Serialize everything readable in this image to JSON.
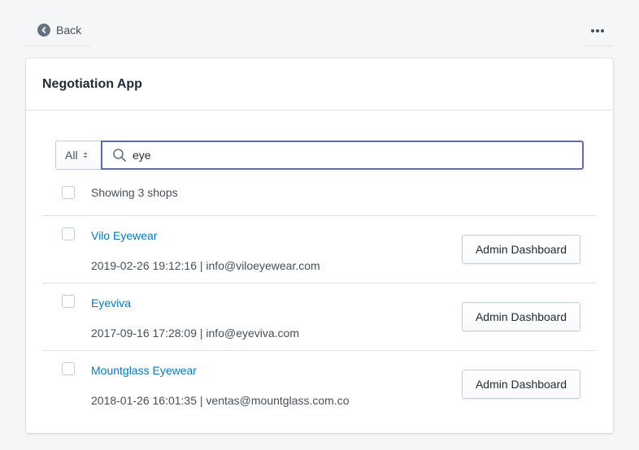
{
  "topbar": {
    "back_label": "Back",
    "back_icon": "chevron-left-circle-icon",
    "more_icon": "horizontal-dots-icon"
  },
  "card": {
    "title": "Negotiation App"
  },
  "filter": {
    "selected": "All",
    "search_value": "eye",
    "search_icon": "search-icon",
    "accent_color": "#5c6ac4"
  },
  "results": {
    "summary": "Showing 3 shops"
  },
  "shops": [
    {
      "name": "Vilo Eyewear",
      "meta": "2019-02-26 19:12:16 | info@viloeyewear.com",
      "action": "Admin Dashboard"
    },
    {
      "name": "Eyeviva",
      "meta": "2017-09-16 17:28:09 | info@eyeviva.com",
      "action": "Admin Dashboard"
    },
    {
      "name": "Mountglass Eyewear",
      "meta": "2018-01-26 16:01:35 | ventas@mountglass.com.co",
      "action": "Admin Dashboard"
    }
  ],
  "colors": {
    "link": "#007ace",
    "background": "#f4f6f8"
  }
}
